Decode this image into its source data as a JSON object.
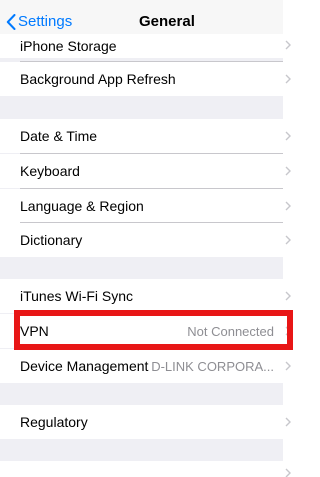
{
  "nav": {
    "back_label": "Settings",
    "title": "General"
  },
  "rows": [
    {
      "label": "iPhone Storage",
      "value": ""
    },
    {
      "label": "Background App Refresh",
      "value": ""
    },
    {
      "label": "Date & Time",
      "value": ""
    },
    {
      "label": "Keyboard",
      "value": ""
    },
    {
      "label": "Language & Region",
      "value": ""
    },
    {
      "label": "Dictionary",
      "value": ""
    },
    {
      "label": "iTunes Wi-Fi Sync",
      "value": ""
    },
    {
      "label": "VPN",
      "value": "Not Connected"
    },
    {
      "label": "Device Management",
      "value": "D-LINK CORPORA..."
    },
    {
      "label": "Regulatory",
      "value": ""
    }
  ],
  "colors": {
    "accent": "#007aff",
    "highlight": "#e81616",
    "group_bg": "#efeff4"
  }
}
